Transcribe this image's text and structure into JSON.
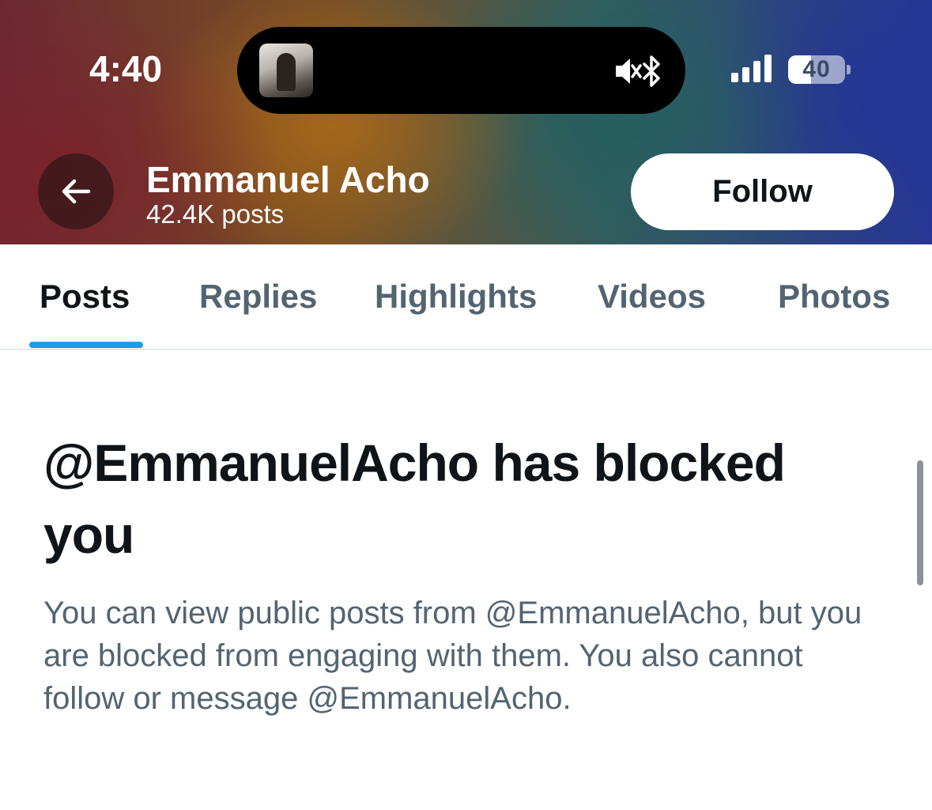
{
  "status_bar": {
    "time": "4:40",
    "battery_level": "40",
    "battery_fraction": 0.4
  },
  "dynamic_island": {
    "icons": [
      "album-art",
      "speaker-muted-icon",
      "bluetooth-icon"
    ]
  },
  "header": {
    "name": "Emmanuel Acho",
    "post_count": "42.4K posts",
    "follow_label": "Follow"
  },
  "tabs": [
    {
      "label": "Posts",
      "active": true
    },
    {
      "label": "Replies",
      "active": false
    },
    {
      "label": "Highlights",
      "active": false
    },
    {
      "label": "Videos",
      "active": false
    },
    {
      "label": "Photos",
      "active": false
    }
  ],
  "blocked": {
    "title": "@EmmanuelAcho has blocked you",
    "description": "You can view public posts from @EmmanuelAcho, but you are blocked from engaging with them. You also cannot follow or message @EmmanuelAcho."
  },
  "colors": {
    "accent": "#1d9bf0",
    "text_primary": "#0f1419",
    "text_secondary": "#536471"
  }
}
